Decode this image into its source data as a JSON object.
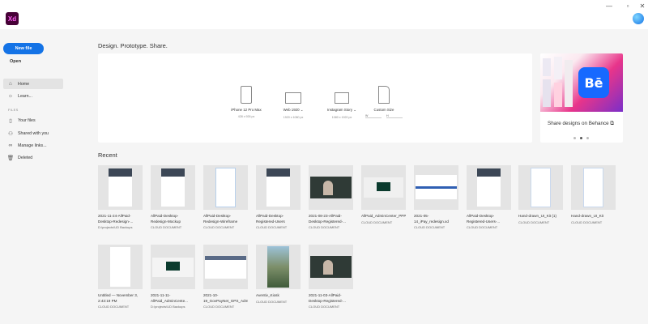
{
  "app": {
    "logo": "Xd"
  },
  "window": {
    "minimize": "—",
    "maximize": "▫",
    "close": "✕"
  },
  "sidebar": {
    "new_file": "New file",
    "open": "Open",
    "section_label": "FILES",
    "items": [
      {
        "label": "Home",
        "icon": "home-icon"
      },
      {
        "label": "Learn...",
        "icon": "lightbulb-icon"
      },
      {
        "label": "Your files",
        "icon": "document-icon"
      },
      {
        "label": "Shared with you",
        "icon": "users-icon"
      },
      {
        "label": "Manage links...",
        "icon": "link-icon"
      },
      {
        "label": "Deleted",
        "icon": "trash-icon"
      }
    ]
  },
  "header": {
    "title": "Design. Prototype. Share."
  },
  "presets": [
    {
      "name": "iPhone 12 Pro Max",
      "size": "428 x 926 px"
    },
    {
      "name": "Web 1920",
      "size": "1920 x 1080 px"
    },
    {
      "name": "Instagram Story",
      "size": "1080 x 1920 px"
    },
    {
      "name": "Custom Size",
      "w_label": "W",
      "h_label": "H"
    }
  ],
  "behance": {
    "text": "Share designs on Behance",
    "logo": "Bē"
  },
  "recent": {
    "title": "Recent",
    "files": [
      {
        "name": "2021-11-24-AllPaid-Desktop-Redesign-...",
        "meta": "D:\\projects\\UD Backups"
      },
      {
        "name": "AllPaid-Desktop-Redesign-Mockup",
        "meta": "CLOUD DOCUMENT"
      },
      {
        "name": "AllPaid-Desktop-Redesign-Wireframe",
        "meta": "CLOUD DOCUMENT"
      },
      {
        "name": "AllPaid-Desktop-Registered-Users",
        "meta": "CLOUD DOCUMENT"
      },
      {
        "name": "2021-08-23-AllPaid-Desktop-Registered-...",
        "meta": "CLOUD DOCUMENT"
      },
      {
        "name": "AllPaid_AdminCenter_PPP_01",
        "meta": "CLOUD DOCUMENT"
      },
      {
        "name": "2021-05-14_iPay_redesign.xd",
        "meta": "CLOUD DOCUMENT"
      },
      {
        "name": "AllPaid-Desktop-Registered-Users-...",
        "meta": "CLOUD DOCUMENT"
      },
      {
        "name": "Hand-drawn_UI_Kit (1)",
        "meta": "CLOUD DOCUMENT"
      },
      {
        "name": "Hand-drawn_UI_Kit",
        "meta": "CLOUD DOCUMENT"
      },
      {
        "name": "Untitled — November 3, 2:43:19 PM",
        "meta": "CLOUD DOCUMENT"
      },
      {
        "name": "2021-11-11-AllPaid_AdminCente...",
        "meta": "D:\\projects\\UD Backups"
      },
      {
        "name": "2021-10-19_GovPayNet_GPS_Admin_Tools",
        "meta": "CLOUD DOCUMENT"
      },
      {
        "name": "Aventiv_Kiosk",
        "meta": "CLOUD DOCUMENT"
      },
      {
        "name": "2021-11-03-AllPaid-Desktop-Registered-...",
        "meta": "CLOUD DOCUMENT"
      }
    ]
  },
  "colors": {
    "accent": "#1473e6",
    "xd_brand": "#470137",
    "behance": "#1769ff"
  }
}
